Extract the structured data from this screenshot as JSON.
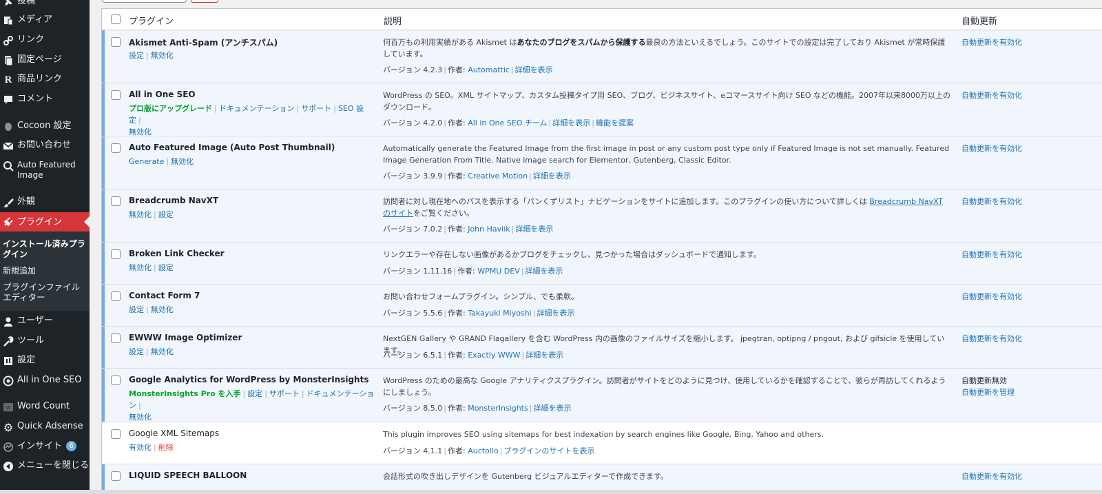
{
  "sidebar": {
    "items": [
      {
        "icon": "pin-icon",
        "label": "投稿"
      },
      {
        "icon": "media-icon",
        "label": "メディア"
      },
      {
        "icon": "link-icon",
        "label": "リンク"
      },
      {
        "icon": "page-icon",
        "label": "固定ページ"
      },
      {
        "icon": "r-logo-icon",
        "label": "商品リンク"
      },
      {
        "icon": "comment-icon",
        "label": "コメント"
      },
      {
        "icon": "cocoon-icon",
        "label": "Cocoon 設定"
      },
      {
        "icon": "mail-icon",
        "label": "お問い合わせ"
      },
      {
        "icon": "image-search-icon",
        "label": "Auto Featured Image"
      },
      {
        "icon": "brush-icon",
        "label": "外観"
      },
      {
        "icon": "plugin-icon",
        "label": "プラグイン"
      },
      {
        "icon": "user-icon",
        "label": "ユーザー"
      },
      {
        "icon": "wrench-icon",
        "label": "ツール"
      },
      {
        "icon": "settings-icon",
        "label": "設定"
      },
      {
        "icon": "aioseo-icon",
        "label": "All in One SEO"
      },
      {
        "icon": "word-count-icon",
        "label": "Word Count"
      },
      {
        "icon": "gear-icon",
        "label": "Quick Adsense"
      },
      {
        "icon": "insights-icon",
        "label": "インサイト",
        "badge": "6"
      },
      {
        "icon": "collapse-icon",
        "label": "メニューを閉じる"
      }
    ],
    "submenu": [
      {
        "label": "インストール済みプラグイン"
      },
      {
        "label": "新規追加"
      },
      {
        "label": "プラグインファイルエディター"
      }
    ]
  },
  "table": {
    "headers": {
      "plugin": "プラグイン",
      "description": "説明",
      "auto_update": "自動更新"
    },
    "plugins": [
      {
        "name": "Akismet Anti-Spam (アンチスパム)",
        "actions": [
          "設定",
          "無効化"
        ],
        "desc_pre": "何百万もの利用実績がある Akismet は",
        "desc_bold": "あなたのブログをスパムから保護する",
        "desc_post": "最良の方法といえるでしょう。このサイトでの設定は完了しており Akismet が常時保護しています。",
        "version": "バージョン 4.2.3",
        "author_label": "作者:",
        "author": "Automattic",
        "details": "詳細を表示",
        "auto": "自動更新を有効化"
      },
      {
        "name": "All in One SEO",
        "action_upgrade": "プロ版にアップグレード",
        "actions": [
          "ドキュメンテーション",
          "サポート",
          "SEO 設定",
          "無効化"
        ],
        "desc": "WordPress の SEO。XML サイトマップ、カスタム投稿タイプ用 SEO、ブログ、ビジネスサイト、eコマースサイト向け SEO などの機能。2007年以来8000万以上のダウンロード。",
        "version": "バージョン 4.2.0",
        "author_label": "作者:",
        "author": "All in One SEO チーム",
        "details": "詳細を表示",
        "extra": "機能を提案",
        "auto": "自動更新を有効化"
      },
      {
        "name": "Auto Featured Image (Auto Post Thumbnail)",
        "actions": [
          "Generate",
          "無効化"
        ],
        "desc": "Automatically generate the Featured Image from the first image in post or any custom post type only if Featured Image is not set manually. Featured Image Generation From Title. Native image search for Elementor, Gutenberg, Classic Editor.",
        "version": "バージョン 3.9.9",
        "author_label": "作者:",
        "author": "Creative Motion",
        "details": "詳細を表示",
        "auto": "自動更新を有効化"
      },
      {
        "name": "Breadcrumb NavXT",
        "actions": [
          "無効化",
          "設定"
        ],
        "desc_pre": "訪問者に対し現在地へのパスを表示する「パンくずリスト」ナビゲーションをサイトに追加します。このプラグインの使い方について詳しくは ",
        "desc_link": "Breadcrumb NavXT のサイト",
        "desc_post": "をご覧ください。",
        "version": "バージョン 7.0.2",
        "author_label": "作者:",
        "author": "John Havlik",
        "details": "詳細を表示",
        "auto": "自動更新を有効化"
      },
      {
        "name": "Broken Link Checker",
        "actions": [
          "無効化",
          "設定"
        ],
        "desc": "リンクエラーや存在しない画像があるかブログをチェックし、見つかった場合はダッシュボードで通知します。",
        "version": "バージョン 1.11.16",
        "author_label": "作者:",
        "author": "WPMU DEV",
        "details": "詳細を表示",
        "auto": "自動更新を有効化"
      },
      {
        "name": "Contact Form 7",
        "actions": [
          "設定",
          "無効化"
        ],
        "desc": "お問い合わせフォームプラグイン。シンプル、でも柔軟。",
        "version": "バージョン 5.5.6",
        "author_label": "作者:",
        "author": "Takayuki Miyoshi",
        "details": "詳細を表示",
        "auto": "自動更新を有効化"
      },
      {
        "name": "EWWW Image Optimizer",
        "actions": [
          "設定",
          "無効化"
        ],
        "desc": "NextGEN Gallery や GRAND Flagallery を含む WordPress 内の画像のファイルサイズを縮小します。 jpegtran, optipng / pngout, および gifsicle を使用しています。",
        "version": "バージョン 6.5.1",
        "author_label": "作者:",
        "author": "Exactly WWW",
        "details": "詳細を表示",
        "auto": "自動更新を有効化"
      },
      {
        "name": "Google Analytics for WordPress by MonsterInsights",
        "action_upgrade": "MonsterInsights Pro を入手",
        "actions": [
          "設定",
          "サポート",
          "ドキュメンテーション",
          "無効化"
        ],
        "desc": "WordPress のための最高な Google アナリティクスプラグイン。訪問者がサイトをどのように見つけ、使用しているかを確認することで、彼らが再訪してくれるようにしましょう。",
        "version": "バージョン 8.5.0",
        "author_label": "作者:",
        "author": "MonsterInsights",
        "details": "詳細を表示",
        "auto_status": "自動更新無効",
        "auto": "自動更新を管理"
      },
      {
        "name": "Google XML Sitemaps",
        "actions": [
          "有効化"
        ],
        "delete": "削除",
        "desc": "This plugin improves SEO using sitemaps for best indexation by search engines like Google, Bing, Yahoo and others.",
        "version": "バージョン 4.1.1",
        "author_label": "作者:",
        "author": "Auctollo",
        "details": "プラグインのサイトを表示"
      },
      {
        "name": "LIQUID SPEECH BALLOON",
        "desc": "会話形式の吹き出しデザインを Gutenberg ビジュアルエディターで作成できます。",
        "auto": "自動更新を有効化"
      }
    ]
  }
}
